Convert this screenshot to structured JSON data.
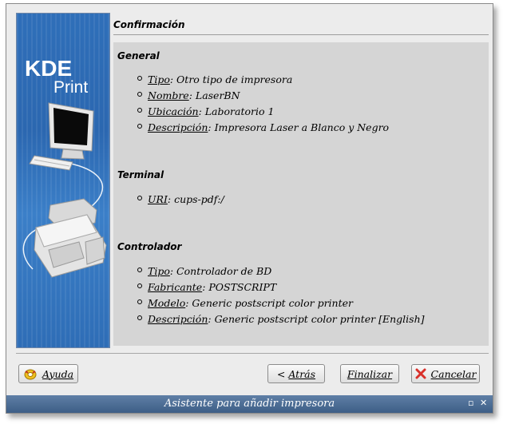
{
  "banner": {
    "logo_line1": "KDE",
    "logo_line2": "Print"
  },
  "page": {
    "title": "Confirmación"
  },
  "sections": {
    "general": {
      "title": "General",
      "items": [
        {
          "key": "Tipo",
          "value": ": Otro tipo de impresora"
        },
        {
          "key": "Nombre",
          "value": ": LaserBN"
        },
        {
          "key": "Ubicación",
          "value": ": Laboratorio 1"
        },
        {
          "key": "Descripción",
          "value": ": Impresora Laser a Blanco y Negro"
        }
      ]
    },
    "terminal": {
      "title": "Terminal",
      "items": [
        {
          "key": "URI",
          "value": ": cups-pdf:/"
        }
      ]
    },
    "controlador": {
      "title": "Controlador",
      "items": [
        {
          "key": "Tipo",
          "value": ": Controlador de BD"
        },
        {
          "key": "Fabricante",
          "value": ": POSTSCRIPT"
        },
        {
          "key": "Modelo",
          "value": ": Generic postscript color printer"
        },
        {
          "key": "Descripción",
          "value": ": Generic postscript color printer [English]"
        }
      ]
    }
  },
  "buttons": {
    "help": {
      "label": "Ayuda",
      "icon": "lifebuoy-icon"
    },
    "back": {
      "prefix": "< ",
      "label": "Atrás"
    },
    "finish": {
      "label": "Finalizar"
    },
    "cancel": {
      "label": "Cancelar",
      "icon": "red-x-icon"
    }
  },
  "window": {
    "title": "Asistente para añadir impresora"
  },
  "colors": {
    "titlebar": "#4a6b93",
    "banner": "#2f6fb9",
    "content_bg": "#d5d5d5",
    "cancel_x": "#d9302a"
  }
}
